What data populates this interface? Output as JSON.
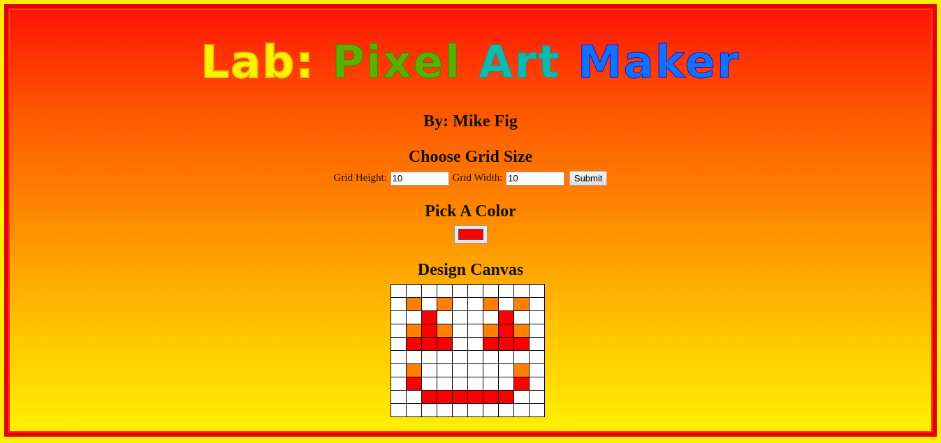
{
  "page": {
    "title_parts": [
      "Lab:",
      "Pixel",
      "Art",
      "Maker"
    ],
    "author": "By: Mike Fig"
  },
  "grid_size": {
    "heading": "Choose Grid Size",
    "height_label": "Grid Height:",
    "height_value": "10",
    "width_label": "Grid Width:",
    "width_value": "10",
    "submit_label": "Submit"
  },
  "color_picker": {
    "heading": "Pick A Color",
    "selected_color": "#ff0000"
  },
  "canvas": {
    "heading": "Design Canvas",
    "rows": 10,
    "cols": 10,
    "colors": {
      "0": "#ffffff",
      "1": "#ff8000",
      "2": "#ff0000"
    },
    "cells": [
      [
        0,
        0,
        0,
        0,
        0,
        0,
        0,
        0,
        0,
        0
      ],
      [
        0,
        1,
        0,
        1,
        0,
        0,
        1,
        0,
        1,
        0
      ],
      [
        0,
        0,
        2,
        0,
        0,
        0,
        0,
        2,
        0,
        0
      ],
      [
        0,
        1,
        2,
        1,
        0,
        0,
        1,
        2,
        1,
        0
      ],
      [
        0,
        2,
        2,
        2,
        0,
        0,
        2,
        2,
        2,
        0
      ],
      [
        0,
        0,
        0,
        0,
        0,
        0,
        0,
        0,
        0,
        0
      ],
      [
        0,
        1,
        0,
        0,
        0,
        0,
        0,
        0,
        1,
        0
      ],
      [
        0,
        2,
        0,
        0,
        0,
        0,
        0,
        0,
        2,
        0
      ],
      [
        0,
        0,
        2,
        2,
        2,
        2,
        2,
        2,
        0,
        0
      ],
      [
        0,
        0,
        0,
        0,
        0,
        0,
        0,
        0,
        0,
        0
      ]
    ]
  },
  "colors": {
    "frame_border": "#e60000",
    "gradient_top": "#ff1405",
    "gradient_bottom": "#fff100"
  }
}
